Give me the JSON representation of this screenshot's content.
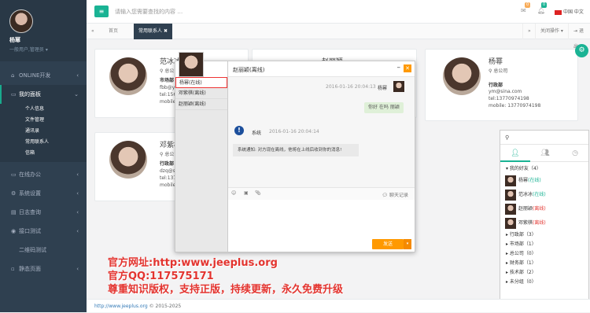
{
  "sidebar": {
    "user_name": "杨幂",
    "user_role": "一般用户,管理员",
    "items": [
      {
        "icon": "home-icon",
        "label": "ONLINE开发"
      },
      {
        "icon": "desktop-icon",
        "label": "我的面板"
      },
      {
        "icon": "desktop-icon",
        "label": "在线办公"
      },
      {
        "icon": "gear-icon",
        "label": "系统设置"
      },
      {
        "icon": "log-icon",
        "label": "日志查询"
      },
      {
        "icon": "api-icon",
        "label": "接口测试"
      },
      {
        "icon": "qrcode-icon",
        "label": "二维码测试"
      },
      {
        "icon": "page-icon",
        "label": "静态页面"
      }
    ],
    "subitems": [
      "个人信息",
      "文件管理",
      "通讯录",
      "常用联系人",
      "信箱"
    ]
  },
  "topbar": {
    "search_placeholder": "请输入您需要查找的内容 …",
    "mail_badge": "0",
    "bell_badge": "0",
    "language": "中国 中文"
  },
  "tabs": {
    "home": "首页",
    "current": "常用联系人",
    "close_ops": "关闭操作",
    "logout": "退出"
  },
  "cards": [
    {
      "name": "范冰冰",
      "company": "总公司",
      "dept": "市场部",
      "line1": "fbb@yahoo",
      "line2": "tel:15652",
      "line3": "mobile: 1"
    },
    {
      "name": "赵丽颖",
      "company": "",
      "dept": "",
      "line1": "",
      "line2": "",
      "line3": ""
    },
    {
      "name": "杨幂",
      "company": "总公司",
      "dept": "行政部",
      "line1": "ym@sina.com",
      "line2": "tel:13770974198",
      "line3": "mobile: 13770974198"
    },
    {
      "name": "邓紫棋",
      "company": "总公司",
      "dept": "行政部",
      "line1": "dzq@sina",
      "line2": "tel:13703",
      "line3": "mobile: 1"
    }
  ],
  "chat": {
    "title": "赵丽颖(离线)",
    "list": [
      "杨幂(在线)",
      "邓紫棋(离线)",
      "赵丽颖(离线)"
    ],
    "msg1_time": "2016-01-16 20:04:13",
    "msg1_sender": "杨幂",
    "msg1_text": "你好 在吗 丽颖",
    "sys_sender": "系统",
    "sys_time": "2016-01-16 20:04:14",
    "sys_text": "系统通知: 对方现在离线，他将在上线后收到你的消息!",
    "history": "聊天记录",
    "send": "发送"
  },
  "contacts": {
    "my_friends": "我的好友",
    "my_friends_count": "（4）",
    "friends": [
      {
        "name": "杨幂",
        "status": "(在线)",
        "status_color": "#1ab394"
      },
      {
        "name": "范冰冰",
        "status": "(在线)",
        "status_color": "#1ab394"
      },
      {
        "name": "赵丽颖",
        "status": "(离线)",
        "status_color": "#e3342f"
      },
      {
        "name": "邓紫棋",
        "status": "(离线)",
        "status_color": "#e3342f"
      }
    ],
    "groups": [
      "行政部（3）",
      "市场部（1）",
      "总公司（0）",
      "财务部（1）",
      "技术部（2）",
      "未分组（0）"
    ]
  },
  "watermark": {
    "line1": "官方网址:http:www.jeeplus.org",
    "line2": "官方QQ:117575171",
    "line3": "尊重知识版权，支持正版，持续更新，永久免费升级"
  },
  "footer": {
    "link": "http://www.jeeplus.org",
    "copyright": "© 2015-2025"
  }
}
